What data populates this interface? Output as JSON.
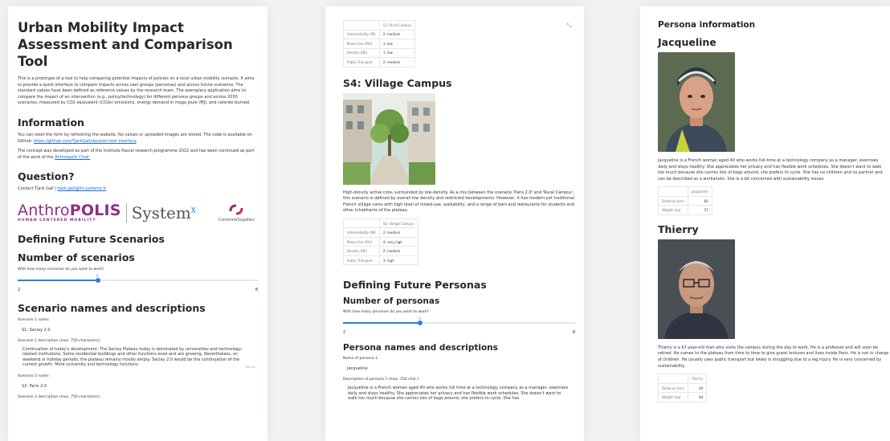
{
  "panel1": {
    "title": "Urban Mobility Impact Assessment and Comparison Tool",
    "intro": "This is a prototype of a tool to help comparing potential impacts of policies on a local urban mobility scenario. It aims to provide a quick interface to compare impacts across user groups (personas) and across future scenarios. The standard values have been defined as reference values by the research team. The exemplary application aims to compare the impact of an intervention (e.g., policy/technology) for different persona groups and across 2030 scenarios, measured by CO2 equivalent (CO2e) emissions, energy demand in mega joule (MJ), and calories burned.",
    "info_heading": "Information",
    "info_text": "You can reset the form by refreshing the website. No values or uploaded images are stored. The code is available on Github: ",
    "info_link": "https://github.com/TjarkGall/decision-tool-interface",
    "concept_text": "The concept was developed as part of the Institute Pascal research programme 2022 and has been continued as part of the work of the ",
    "concept_link": "Anthropolis Chair.",
    "question_heading": "Question?",
    "contact_text": "Contact Tjark Gall | ",
    "contact_email": "tjark.gall@irt-systemx.fr",
    "logo_anthropolis_a": "Anthro",
    "logo_anthropolis_b": "POLIS",
    "logo_anthropolis_tagline": "HUMAN CENTERED MOBILITY",
    "logo_systemx": "System",
    "logo_systemx_x": "x",
    "logo_centrale": "CentraleSupélec",
    "defining_heading": "Defining Future Scenarios",
    "num_heading": "Number of scenarios",
    "num_question": "With how many scenarios do you want to work?",
    "slider_min": "2",
    "slider_max": "8",
    "slider_value": "4",
    "names_heading": "Scenario names and descriptions",
    "s1_name_label": "Scenario 1 name:",
    "s1_name_value": "S1: Saclay 2.0",
    "s1_desc_label": "Scenario 1 description (max. 750 characters):",
    "s1_desc_value": "Continuation of today's development. The Saclay Plateau today is dominated by universities and technology-related institutions. Some residential buildings and other functions exist and are growing. Nevertheless, on weekend or holiday periods, the plateau remains mostly empty. Saclay 2.0 would be the continuation of the current growth. More university and technology functions",
    "s1_desc_count": "386/750",
    "s2_name_label": "Scenario 2 name:",
    "s2_name_value": "S2: Paris 2.0",
    "s2_desc_label": "Scenario 2 description (max. 750 characters):"
  },
  "panel2": {
    "table1_header": "S3: Rural Campus",
    "table1_rows": [
      {
        "label": "Intermodality (IM)",
        "value": "2: medium"
      },
      {
        "label": "Mixed Use (MU)",
        "value": "1: low"
      },
      {
        "label": "Density (DE)",
        "value": "1: low"
      },
      {
        "label": "Public Transport",
        "value": "2: medium"
      }
    ],
    "s4_heading": "S4: Village Campus",
    "s4_desc": "High-density active core, surrounded by low-density. As a mix between the scenario 'Paris 2.0' and 'Rural Campus', this scenario is defined by overall low density and restricted developments. However, it has modern-yet traditional French village cores with high level of mixed-use, walkability, and a range of bars and restaurants for students and other inhabitants of the plateau.",
    "table2_header": "S4: Village Campus",
    "table2_rows": [
      {
        "label": "Intermodality (IM)",
        "value": "2: medium"
      },
      {
        "label": "Mixed Use (MU)",
        "value": "4: very high"
      },
      {
        "label": "Density (DE)",
        "value": "2: medium"
      },
      {
        "label": "Public Transport",
        "value": "3: high"
      }
    ],
    "personas_heading": "Defining Future Personas",
    "num_heading": "Number of personas",
    "num_question": "With how many personas do you want to work?",
    "slider_min": "2",
    "slider_max": "8",
    "slider_value": "4",
    "names_heading": "Persona names and descriptions",
    "p1_name_label": "Name of persona 1:",
    "p1_name_value": "Jacqueline",
    "p1_desc_label": "Description of persona 1 (max. 250 char.):",
    "p1_desc_value": "Jacqueline is a French woman aged 40 who works full time at a technology company as a manager, exercises daily and stays healthy. She appreciates her privacy and has flexible work schedules. She doesn't want to walk too much because she carries lots of bags around, she prefers to cycle. She has"
  },
  "panel3": {
    "heading": "Persona information",
    "j_name": "Jacqueline",
    "j_desc": "Jacqueline is a French woman aged 40 who works full-time at a technology company as a manager, exercises daily and stays healthy. She appreciates her privacy and has flexible work schedules. She doesn't want to walk too much because she carries lots of bags around, she prefers to cycle. She has no children and no partner and can be described as a workaholic. She is a bit concerned with sustainability issues.",
    "j_table_header": "Jacqueline",
    "j_rows": [
      {
        "label": "Distance (km)",
        "value": "60"
      },
      {
        "label": "Weight (kg)",
        "value": "57"
      }
    ],
    "t_name": "Thierry",
    "t_desc": "Thierry is a 67-year-old man who visits the campus during the day to work. He is a professor and will soon be retired. He comes to the plateau from time to time to give guest lectures and lives inside Paris. He is not in charge of children. He usually uses public transport but lately is struggling due to a leg injury. He is very concerned by sustainability.",
    "t_table_header": "Thierry",
    "t_rows": [
      {
        "label": "Distance (km)",
        "value": "40"
      },
      {
        "label": "Weight (kg)",
        "value": "84"
      }
    ]
  },
  "colors": {
    "accent": "#2c7fe0",
    "anthropolis": "#8e2f86",
    "link": "#1c66d6"
  }
}
